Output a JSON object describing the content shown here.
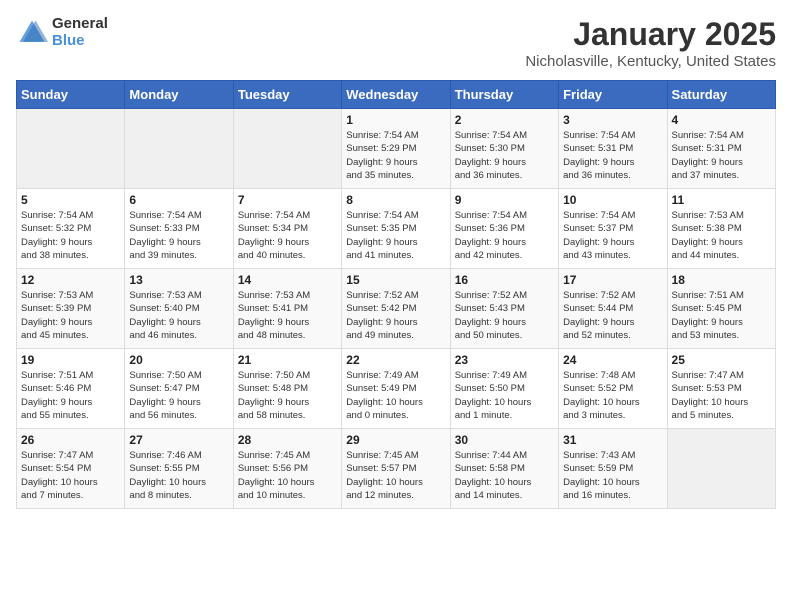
{
  "header": {
    "logo_general": "General",
    "logo_blue": "Blue",
    "title": "January 2025",
    "subtitle": "Nicholasville, Kentucky, United States"
  },
  "weekdays": [
    "Sunday",
    "Monday",
    "Tuesday",
    "Wednesday",
    "Thursday",
    "Friday",
    "Saturday"
  ],
  "weeks": [
    [
      {
        "day": "",
        "info": ""
      },
      {
        "day": "",
        "info": ""
      },
      {
        "day": "",
        "info": ""
      },
      {
        "day": "1",
        "info": "Sunrise: 7:54 AM\nSunset: 5:29 PM\nDaylight: 9 hours\nand 35 minutes."
      },
      {
        "day": "2",
        "info": "Sunrise: 7:54 AM\nSunset: 5:30 PM\nDaylight: 9 hours\nand 36 minutes."
      },
      {
        "day": "3",
        "info": "Sunrise: 7:54 AM\nSunset: 5:31 PM\nDaylight: 9 hours\nand 36 minutes."
      },
      {
        "day": "4",
        "info": "Sunrise: 7:54 AM\nSunset: 5:31 PM\nDaylight: 9 hours\nand 37 minutes."
      }
    ],
    [
      {
        "day": "5",
        "info": "Sunrise: 7:54 AM\nSunset: 5:32 PM\nDaylight: 9 hours\nand 38 minutes."
      },
      {
        "day": "6",
        "info": "Sunrise: 7:54 AM\nSunset: 5:33 PM\nDaylight: 9 hours\nand 39 minutes."
      },
      {
        "day": "7",
        "info": "Sunrise: 7:54 AM\nSunset: 5:34 PM\nDaylight: 9 hours\nand 40 minutes."
      },
      {
        "day": "8",
        "info": "Sunrise: 7:54 AM\nSunset: 5:35 PM\nDaylight: 9 hours\nand 41 minutes."
      },
      {
        "day": "9",
        "info": "Sunrise: 7:54 AM\nSunset: 5:36 PM\nDaylight: 9 hours\nand 42 minutes."
      },
      {
        "day": "10",
        "info": "Sunrise: 7:54 AM\nSunset: 5:37 PM\nDaylight: 9 hours\nand 43 minutes."
      },
      {
        "day": "11",
        "info": "Sunrise: 7:53 AM\nSunset: 5:38 PM\nDaylight: 9 hours\nand 44 minutes."
      }
    ],
    [
      {
        "day": "12",
        "info": "Sunrise: 7:53 AM\nSunset: 5:39 PM\nDaylight: 9 hours\nand 45 minutes."
      },
      {
        "day": "13",
        "info": "Sunrise: 7:53 AM\nSunset: 5:40 PM\nDaylight: 9 hours\nand 46 minutes."
      },
      {
        "day": "14",
        "info": "Sunrise: 7:53 AM\nSunset: 5:41 PM\nDaylight: 9 hours\nand 48 minutes."
      },
      {
        "day": "15",
        "info": "Sunrise: 7:52 AM\nSunset: 5:42 PM\nDaylight: 9 hours\nand 49 minutes."
      },
      {
        "day": "16",
        "info": "Sunrise: 7:52 AM\nSunset: 5:43 PM\nDaylight: 9 hours\nand 50 minutes."
      },
      {
        "day": "17",
        "info": "Sunrise: 7:52 AM\nSunset: 5:44 PM\nDaylight: 9 hours\nand 52 minutes."
      },
      {
        "day": "18",
        "info": "Sunrise: 7:51 AM\nSunset: 5:45 PM\nDaylight: 9 hours\nand 53 minutes."
      }
    ],
    [
      {
        "day": "19",
        "info": "Sunrise: 7:51 AM\nSunset: 5:46 PM\nDaylight: 9 hours\nand 55 minutes."
      },
      {
        "day": "20",
        "info": "Sunrise: 7:50 AM\nSunset: 5:47 PM\nDaylight: 9 hours\nand 56 minutes."
      },
      {
        "day": "21",
        "info": "Sunrise: 7:50 AM\nSunset: 5:48 PM\nDaylight: 9 hours\nand 58 minutes."
      },
      {
        "day": "22",
        "info": "Sunrise: 7:49 AM\nSunset: 5:49 PM\nDaylight: 10 hours\nand 0 minutes."
      },
      {
        "day": "23",
        "info": "Sunrise: 7:49 AM\nSunset: 5:50 PM\nDaylight: 10 hours\nand 1 minute."
      },
      {
        "day": "24",
        "info": "Sunrise: 7:48 AM\nSunset: 5:52 PM\nDaylight: 10 hours\nand 3 minutes."
      },
      {
        "day": "25",
        "info": "Sunrise: 7:47 AM\nSunset: 5:53 PM\nDaylight: 10 hours\nand 5 minutes."
      }
    ],
    [
      {
        "day": "26",
        "info": "Sunrise: 7:47 AM\nSunset: 5:54 PM\nDaylight: 10 hours\nand 7 minutes."
      },
      {
        "day": "27",
        "info": "Sunrise: 7:46 AM\nSunset: 5:55 PM\nDaylight: 10 hours\nand 8 minutes."
      },
      {
        "day": "28",
        "info": "Sunrise: 7:45 AM\nSunset: 5:56 PM\nDaylight: 10 hours\nand 10 minutes."
      },
      {
        "day": "29",
        "info": "Sunrise: 7:45 AM\nSunset: 5:57 PM\nDaylight: 10 hours\nand 12 minutes."
      },
      {
        "day": "30",
        "info": "Sunrise: 7:44 AM\nSunset: 5:58 PM\nDaylight: 10 hours\nand 14 minutes."
      },
      {
        "day": "31",
        "info": "Sunrise: 7:43 AM\nSunset: 5:59 PM\nDaylight: 10 hours\nand 16 minutes."
      },
      {
        "day": "",
        "info": ""
      }
    ]
  ]
}
